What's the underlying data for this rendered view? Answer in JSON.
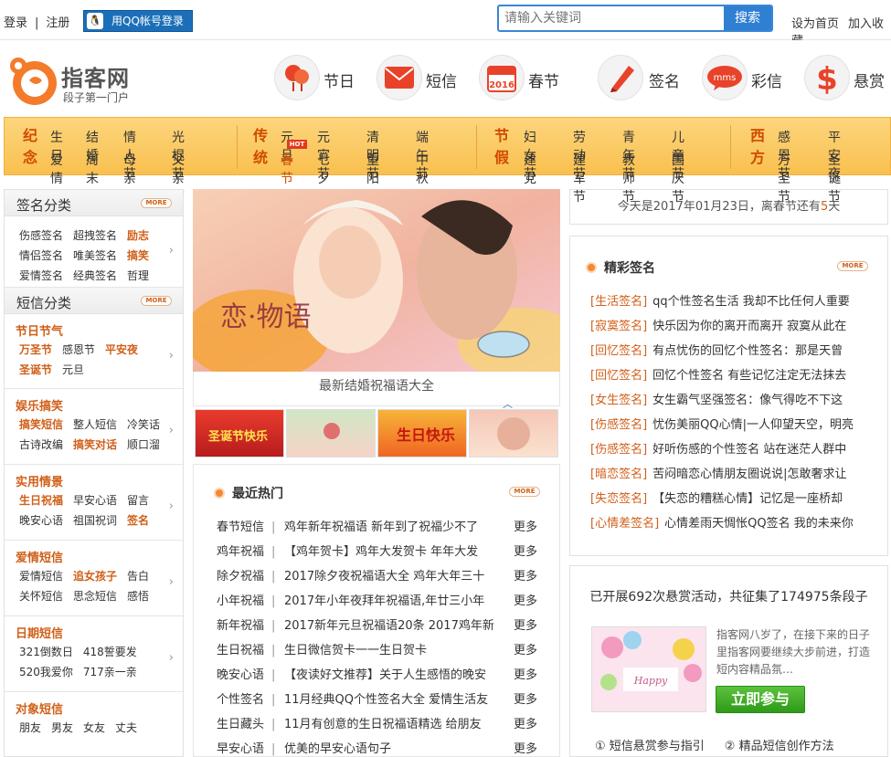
{
  "topbar": {
    "login": "登录",
    "sep": "|",
    "register": "注册",
    "qq_login": "用QQ帐号登录",
    "search_placeholder": "请输入关键词",
    "search_button": "搜索",
    "set_home": "设为首页",
    "add_favorite": "加入收藏"
  },
  "logo": {
    "name": "指客网",
    "slogan": "段子第一门户"
  },
  "nav": [
    {
      "label": "节日",
      "icon": "lantern-icon"
    },
    {
      "label": "短信",
      "icon": "envelope-icon"
    },
    {
      "label": "春节",
      "icon": "calendar-icon",
      "badge": "2016"
    },
    {
      "label": "签名",
      "icon": "pen-icon"
    },
    {
      "label": "彩信",
      "icon": "mms-icon",
      "badge": "mms"
    },
    {
      "label": "悬赏",
      "icon": "dollar-icon",
      "badge": "$"
    }
  ],
  "categories": {
    "group1": {
      "tag1": "纪",
      "tag2": "念",
      "row1": [
        "生日",
        "结婚",
        "情人节",
        "光棍节"
      ],
      "row2": [
        "爱情",
        "周末",
        "母亲节",
        "父亲节"
      ]
    },
    "group2": {
      "tag1": "传",
      "tag2": "统",
      "row1": [
        "元旦",
        "元宵节",
        "清明节",
        "端午节"
      ],
      "row2": [
        "春节",
        "七夕节",
        "重阳节",
        "中秋节"
      ],
      "hot_label": "HOT"
    },
    "group3": {
      "tag1": "节",
      "tag2": "假",
      "row1": [
        "妇女节",
        "劳动节",
        "青年节",
        "儿童节"
      ],
      "row2": [
        "建党节",
        "建军节",
        "教师节",
        "国庆节"
      ]
    },
    "group4": {
      "tag1": "西",
      "tag2": "方",
      "row1": [
        "感恩节",
        "平安夜"
      ],
      "row2": [
        "万圣节",
        "圣诞节"
      ]
    }
  },
  "more_label": "MORE",
  "left": {
    "sig_title": "签名分类",
    "sig_rows": [
      [
        "伤感签名",
        "超拽签名",
        "励志"
      ],
      [
        "情侣签名",
        "唯美签名",
        "搞笑"
      ],
      [
        "爱情签名",
        "经典签名",
        "哲理"
      ]
    ],
    "sms_title": "短信分类",
    "blocks": [
      {
        "title": "节日节气",
        "rows": [
          [
            "万圣节",
            "感恩节",
            "平安夜"
          ],
          [
            "圣诞节",
            "元旦"
          ]
        ]
      },
      {
        "title": "娱乐搞笑",
        "rows": [
          [
            "搞笑短信",
            "整人短信",
            "冷笑话"
          ],
          [
            "古诗改编",
            "搞笑对话",
            "顺口溜"
          ]
        ]
      },
      {
        "title": "实用情景",
        "rows": [
          [
            "生日祝福",
            "早安心语",
            "留言"
          ],
          [
            "晚安心语",
            "祖国祝词",
            "签名"
          ]
        ]
      },
      {
        "title": "爱情短信",
        "rows": [
          [
            "爱情短信",
            "追女孩子",
            "告白"
          ],
          [
            "关怀短信",
            "思念短信",
            "感悟"
          ]
        ]
      },
      {
        "title": "日期短信",
        "rows": [
          [
            "321倒数日",
            "418誓要发"
          ],
          [
            "520我爱你",
            "717亲一亲"
          ]
        ]
      },
      {
        "title": "对象短信",
        "rows": [
          [
            "朋友",
            "男友",
            "女友",
            "丈夫"
          ]
        ]
      }
    ]
  },
  "banner": {
    "caption": "最新结婚祝福语大全",
    "art_text": "恋·物语"
  },
  "thumbs": [
    {
      "text": "圣诞节快乐"
    },
    {
      "text": ""
    },
    {
      "text": "生日快乐"
    },
    {
      "text": ""
    }
  ],
  "hot": {
    "title": "最近热门",
    "rows": [
      {
        "cat": "春节短信",
        "text": "鸡年新年祝福语 新年到了祝福少不了",
        "more": "更多"
      },
      {
        "cat": "鸡年祝福",
        "text": "【鸡年贺卡】鸡年大发贺卡 年年大发",
        "more": "更多"
      },
      {
        "cat": "除夕祝福",
        "text": "2017除夕夜祝福语大全 鸡年大年三十",
        "more": "更多"
      },
      {
        "cat": "小年祝福",
        "text": "2017年小年夜拜年祝福语,年廿三小年",
        "more": "更多"
      },
      {
        "cat": "新年祝福",
        "text": "2017新年元旦祝福语20条 2017鸡年新",
        "more": "更多"
      },
      {
        "cat": "生日祝福",
        "text": "生日微信贺卡一一生日贺卡",
        "more": "更多"
      },
      {
        "cat": "晚安心语",
        "text": "【夜读好文推荐】关于人生感悟的晚安",
        "more": "更多"
      },
      {
        "cat": "个性签名",
        "text": "11月经典QQ个性签名大全 爱情生活友",
        "more": "更多"
      },
      {
        "cat": "生日藏头",
        "text": "11月有创意的生日祝福语精选 给朋友",
        "more": "更多"
      },
      {
        "cat": "早安心语",
        "text": "优美的早安心语句子",
        "more": "更多"
      }
    ]
  },
  "date": {
    "prefix": "今天是2017年01月23日，离春节还有",
    "days": "5",
    "suffix": "天"
  },
  "signatures": {
    "title": "精彩签名",
    "rows": [
      {
        "cat": "[生活签名]",
        "text": "qq个性签名生活 我却不比任何人重要"
      },
      {
        "cat": "[寂寞签名]",
        "text": "快乐因为你的离开而离开 寂寞从此在"
      },
      {
        "cat": "[回忆签名]",
        "text": "有点忧伤的回忆个性签名：那是天曾"
      },
      {
        "cat": "[回忆签名]",
        "text": "回忆个性签名 有些记忆注定无法抹去"
      },
      {
        "cat": "[女生签名]",
        "text": "女生霸气坚强签名：像气得吃不下这"
      },
      {
        "cat": "[伤感签名]",
        "text": "忧伤美丽QQ心情|一人仰望天空，明亮"
      },
      {
        "cat": "[伤感签名]",
        "text": "好听伤感的个性签名 站在迷茫人群中"
      },
      {
        "cat": "[暗恋签名]",
        "text": "苦闷暗恋心情朋友圈说说|怎敢奢求让"
      },
      {
        "cat": "[失恋签名]",
        "text": "【失恋的糟糕心情】记忆是一座桥却"
      },
      {
        "cat": "[心情差签名]",
        "text": "心情差雨天惆怅QQ签名 我的未来你"
      }
    ]
  },
  "reward": {
    "title": "已开展692次悬赏活动，共征集了174975条段子",
    "desc": "指客网八岁了，在接下来的日子里指客网要继续大步前进，打造短内容精品氛…",
    "join": "立即参与",
    "link1": "① 短信悬赏参与指引",
    "link2": "② 精品短信创作方法",
    "img_text": "Happy"
  },
  "colors": {
    "accent": "#d0601a",
    "catbar": "#f9c04f",
    "search": "#2f7fd2",
    "join": "#2e9a19"
  }
}
